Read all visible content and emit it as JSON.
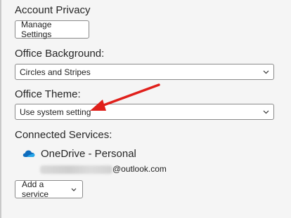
{
  "account_privacy": {
    "heading": "Account Privacy",
    "manage_button": "Manage Settings"
  },
  "office_background": {
    "heading": "Office Background:",
    "selected": "Circles and Stripes"
  },
  "office_theme": {
    "heading": "Office Theme:",
    "selected": "Use system setting"
  },
  "connected_services": {
    "heading": "Connected Services:",
    "service_name": "OneDrive - Personal",
    "email_domain": "@outlook.com",
    "add_button": "Add a service"
  },
  "icons": {
    "cloud": "onedrive-cloud-icon",
    "dropdown": "chevron-down-icon"
  },
  "colors": {
    "annotation_arrow": "#e0201b",
    "onedrive_blue": "#0f6cbd"
  }
}
